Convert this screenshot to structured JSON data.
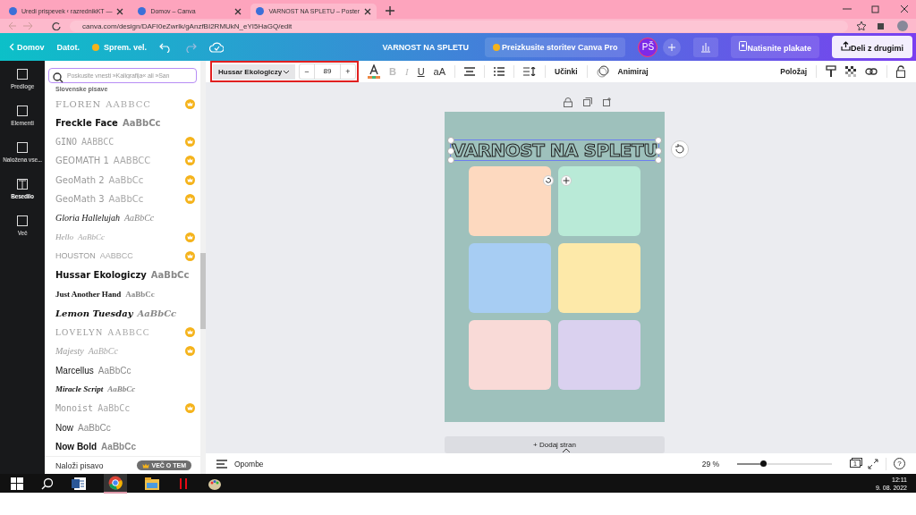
{
  "browser": {
    "tabs": [
      {
        "title": "Uredi prispevek ‹ razrednikKT —",
        "selected": false
      },
      {
        "title": "Domov – Canva",
        "selected": false
      },
      {
        "title": "VARNOST NA SPLETU – Poster",
        "selected": true
      }
    ],
    "url": "canva.com/design/DAFI0eZwrlk/gAnzfBI2RMUkN_eYI5HaGQ/edit"
  },
  "header": {
    "home": "Domov",
    "file": "Datot.",
    "resize": "Sprem. vel.",
    "design_title": "VARNOST NA SPLETU",
    "pro_button": "Preizkusite storitev Canva Pro",
    "avatar": "PŠ",
    "print_button": "Natisnite plakate",
    "share_button": "Deli z drugimi"
  },
  "rail": [
    {
      "label": "Predloge",
      "selected": false
    },
    {
      "label": "Elementi",
      "selected": false
    },
    {
      "label": "Naložena vse...",
      "selected": false
    },
    {
      "label": "Besedilo",
      "selected": true
    },
    {
      "label": "Več",
      "selected": false
    }
  ],
  "font_panel": {
    "search_placeholder": "Poskusite vnesti »Kaligrafija« ali »San",
    "section": "Slovenske pisave",
    "fonts": [
      {
        "name": "FLOREN",
        "sample": "AABBCC",
        "pro": true
      },
      {
        "name": "Freckle Face",
        "sample": "AaBbCc",
        "pro": false
      },
      {
        "name": "GINO",
        "sample": "AABBCC",
        "pro": true
      },
      {
        "name": "GEOMATH 1",
        "sample": "AABBCC",
        "pro": true
      },
      {
        "name": "GeoMath 2",
        "sample": "AaBbCc",
        "pro": true
      },
      {
        "name": "GeoMath 3",
        "sample": "AaBbCc",
        "pro": true
      },
      {
        "name": "Gloria Hallelujah",
        "sample": "AaBbCc",
        "pro": false
      },
      {
        "name": "Hello",
        "sample": "AaBbCc",
        "pro": true
      },
      {
        "name": "HOUSTON",
        "sample": "AABBCC",
        "pro": true
      },
      {
        "name": "Hussar Ekologiczy",
        "sample": "AaBbCc",
        "pro": false
      },
      {
        "name": "Just Another Hand",
        "sample": "AaBbCc",
        "pro": false
      },
      {
        "name": "Lemon Tuesday",
        "sample": "AaBbCc",
        "pro": false
      },
      {
        "name": "LOVELYN",
        "sample": "AABBCC",
        "pro": true
      },
      {
        "name": "Majesty",
        "sample": "AaBbCc",
        "pro": true
      },
      {
        "name": "Marcellus",
        "sample": "AaBbCc",
        "pro": false
      },
      {
        "name": "Miracle Script",
        "sample": "AaBbCc",
        "pro": false
      },
      {
        "name": "Monoist",
        "sample": "AaBbCc",
        "pro": true
      },
      {
        "name": "Now",
        "sample": "AaBbCc",
        "pro": false
      },
      {
        "name": "Now Bold",
        "sample": "AaBbCc",
        "pro": false
      }
    ],
    "upload": "Naloži pisavo",
    "more_badge": "VEČ O TEM"
  },
  "toolbar": {
    "font": "Hussar Ekologiczy",
    "minus": "−",
    "size": "89",
    "plus": "+",
    "format": [
      {
        "label": "B",
        "disabled": true
      },
      {
        "label": "I",
        "disabled": true
      },
      {
        "label": "U",
        "disabled": false
      },
      {
        "label": "aA",
        "disabled": false
      }
    ],
    "effects": "Učinki",
    "animate": "Animiraj",
    "position": "Položaj"
  },
  "poster": {
    "title": "VARNOST NA SPLETU",
    "boxes": [
      {
        "color": "#fdd9bf"
      },
      {
        "color": "#b9ead7"
      },
      {
        "color": "#a7cdf3"
      },
      {
        "color": "#fde9a9"
      },
      {
        "color": "#f9dad7"
      },
      {
        "color": "#dad1ef"
      }
    ]
  },
  "add_page": "+ Dodaj stran",
  "footer": {
    "notes": "Opombe",
    "zoom": "29 %",
    "level": 0.27,
    "page": "1",
    "help": "?"
  },
  "taskbar": {
    "time": "12:11",
    "date": "9. 08. 2022"
  }
}
